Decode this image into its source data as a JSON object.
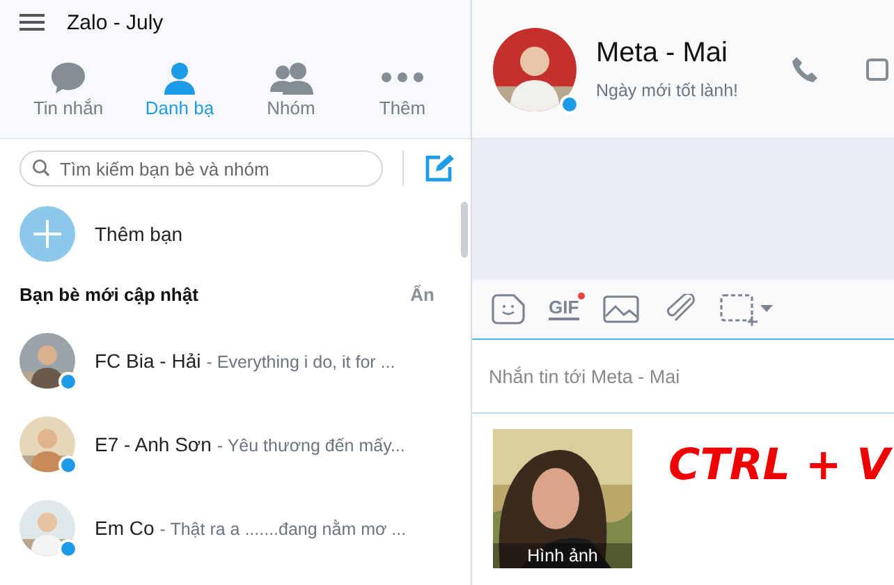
{
  "window": {
    "title": "Zalo - July"
  },
  "tabs": [
    {
      "label": "Tin nhắn",
      "kind": "chat",
      "selected": false
    },
    {
      "label": "Danh bạ",
      "kind": "contacts",
      "selected": true
    },
    {
      "label": "Nhóm",
      "kind": "groups",
      "selected": false
    },
    {
      "label": "Thêm",
      "kind": "more",
      "selected": false
    }
  ],
  "search": {
    "placeholder": "Tìm kiếm bạn bè và nhóm"
  },
  "add_friend": {
    "label": "Thêm bạn"
  },
  "section": {
    "title": "Bạn bè mới cập nhật",
    "action": "Ẩn"
  },
  "contacts": [
    {
      "name": "FC Bia - Hải",
      "status": "- Everything i do, it for ...",
      "online": true
    },
    {
      "name": "E7 - Anh Sơn",
      "status": "- Yêu thương đến mấy...",
      "online": true
    },
    {
      "name": "Em Co",
      "status": "- Thật ra a .......đang nằm mơ ...",
      "online": true
    }
  ],
  "chat": {
    "name": "Meta - Mai",
    "status": "Ngày mới tốt lành!",
    "online": true,
    "toolbar": {
      "gif_label": "GIF",
      "gif_new": true
    },
    "composer": {
      "placeholder": "Nhắn tin tới Meta - Mai"
    },
    "attachment": {
      "kind": "picture",
      "caption": "Hình ảnh"
    },
    "annotation": "CTRL + V"
  }
}
